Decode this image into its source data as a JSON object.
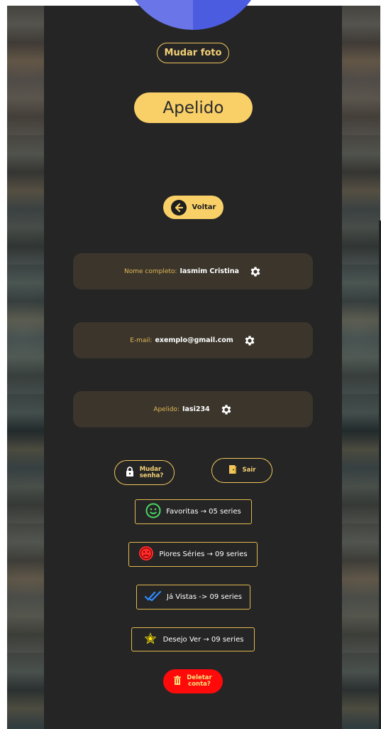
{
  "profile": {
    "change_photo_label": "Mudar foto",
    "nickname_title": "Apelido"
  },
  "nav": {
    "back_label": "Voltar"
  },
  "fields": [
    {
      "label": "Nome completo:",
      "value": "Iasmim Cristina"
    },
    {
      "label": "E-mail:",
      "value": "exemplo@gmail.com"
    },
    {
      "label": "Apelido:",
      "value": "Iasi234"
    }
  ],
  "actions": {
    "change_password_line1": "Mudar",
    "change_password_line2": "senha?",
    "logout_label": "Sair",
    "delete_line1": "Deletar",
    "delete_line2": "conta?"
  },
  "lists": [
    {
      "label": "Favoritas → 05 series",
      "icon": "smiley-face-icon",
      "color": "#4cd964"
    },
    {
      "label": "Piores Séries → 09 series",
      "icon": "sad-face-icon",
      "color": "#ff2d2d"
    },
    {
      "label": "Já Vistas -> 09 series",
      "icon": "double-check-icon",
      "color": "#2f8cff"
    },
    {
      "label": "Desejo Ver → 09 series",
      "icon": "star-icon",
      "color": "#ffe600"
    }
  ],
  "colors": {
    "accent": "#f9d068",
    "panel": "#252526",
    "card": "#3b352b",
    "danger": "#ff0a0a"
  }
}
